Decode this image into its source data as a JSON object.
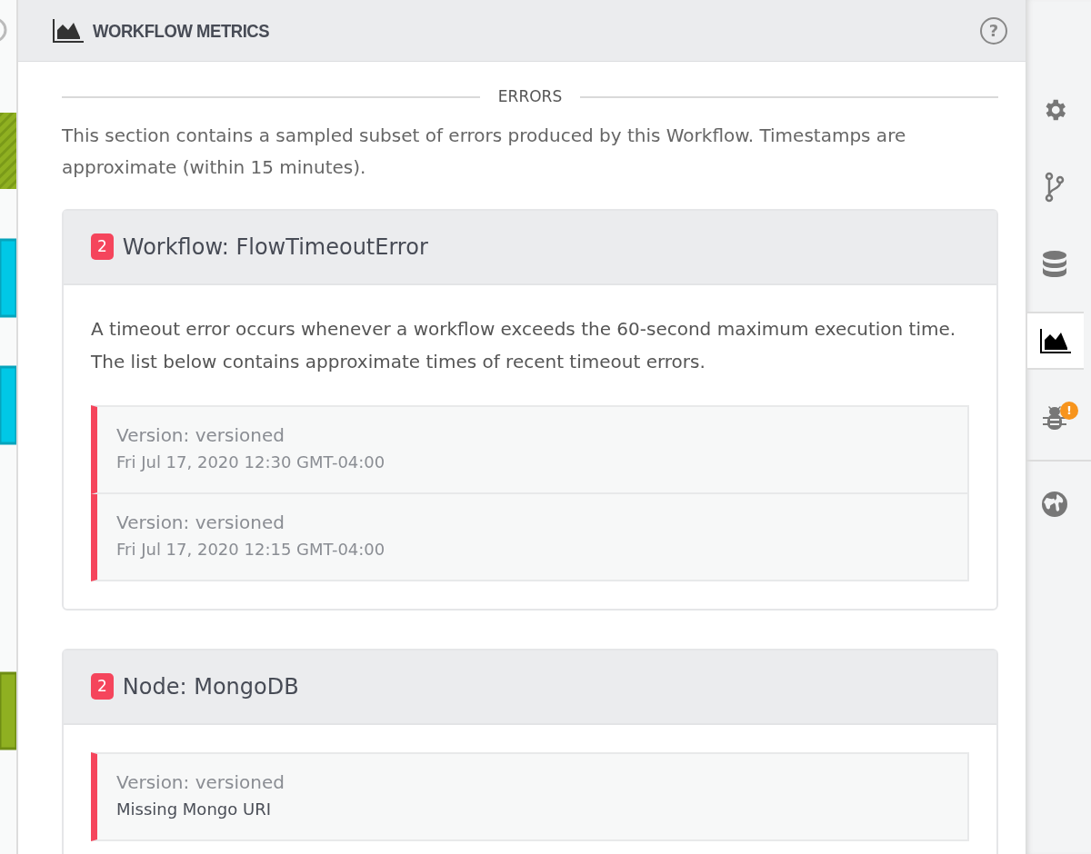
{
  "panel": {
    "title": "WORKFLOW METRICS",
    "help": "?"
  },
  "section_title": "ERRORS",
  "intro": "This section contains a sampled subset of errors produced by this Workflow. Timestamps are approximate (within 15 minutes).",
  "errors": [
    {
      "count": "2",
      "title": "Workflow: FlowTimeoutError",
      "description": "A timeout error occurs whenever a workflow exceeds the 60-second maximum execution time. The list below contains approximate times of recent timeout errors.",
      "occurrences": [
        {
          "version": "Version: versioned",
          "detail": "Fri Jul 17, 2020 12:30 GMT-04:00",
          "kind": "timestamp"
        },
        {
          "version": "Version: versioned",
          "detail": "Fri Jul 17, 2020 12:15 GMT-04:00",
          "kind": "timestamp"
        }
      ]
    },
    {
      "count": "2",
      "title": "Node: MongoDB",
      "occurrences": [
        {
          "version": "Version: versioned",
          "detail": "Missing Mongo URI",
          "kind": "message"
        }
      ]
    }
  ],
  "rail": [
    {
      "kind": "settings",
      "selected": false
    },
    {
      "kind": "branch",
      "selected": false
    },
    {
      "kind": "database",
      "selected": false
    },
    {
      "kind": "chart",
      "selected": true
    },
    {
      "kind": "bug",
      "selected": false,
      "badge": "!"
    },
    {
      "kind": "globe",
      "selected": false
    }
  ]
}
